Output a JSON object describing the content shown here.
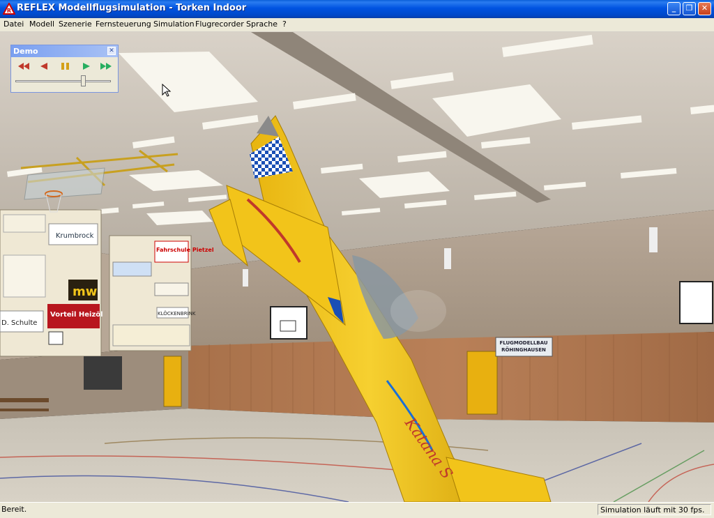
{
  "window": {
    "title": "REFLEX Modellflugsimulation - Torken Indoor"
  },
  "menu": [
    "Datei",
    "Modell",
    "Szenerie",
    "Fernsteuerung",
    "Simulation",
    "Flugrecorder",
    "Sprache",
    "?"
  ],
  "demo_panel": {
    "title": "Demo",
    "controls": [
      "rewind-icon",
      "step-back-icon",
      "pause-icon",
      "play-icon",
      "fast-forward-icon"
    ],
    "slider_position": 0.72
  },
  "status": {
    "left": "Bereit.",
    "right": "Simulation läuft mit 30 fps."
  },
  "scene": {
    "banner_right": "FLUGMODELLBAU",
    "banner_right_2": "RÖHINGHAUSEN",
    "ad_1": "Fahrschule Pietzel",
    "ad_2": "Vorteil Heizöl",
    "ad_3": "D. Schulte",
    "ad_4": "Krumbrock",
    "ad_5": "KLÖCKENBRINK",
    "ad_6": "mw",
    "plane_text": "Katana S"
  },
  "colors": {
    "titlebar": "#0053e1",
    "plane": "#f2c41a"
  }
}
